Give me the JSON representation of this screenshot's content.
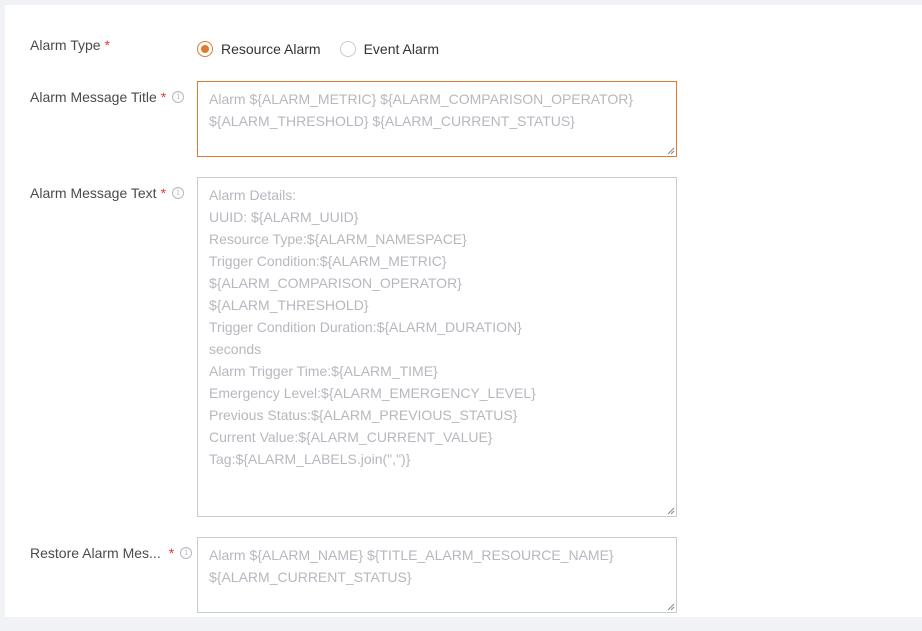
{
  "form": {
    "alarm_type": {
      "label": "Alarm Type",
      "required_mark": "*",
      "options": [
        {
          "label": "Resource Alarm",
          "checked": true
        },
        {
          "label": "Event Alarm",
          "checked": false
        }
      ]
    },
    "message_title": {
      "label": "Alarm Message Title",
      "required_mark": "*",
      "info_icon": "ⓘ",
      "placeholder": "Alarm ${ALARM_METRIC} ${ALARM_COMPARISON_OPERATOR} ${ALARM_THRESHOLD} ${ALARM_CURRENT_STATUS}"
    },
    "message_text": {
      "label": "Alarm Message Text",
      "required_mark": "*",
      "info_icon": "ⓘ",
      "placeholder": "Alarm Details:\nUUID: ${ALARM_UUID}\nResource Type:${ALARM_NAMESPACE}\nTrigger Condition:${ALARM_METRIC}\n${ALARM_COMPARISON_OPERATOR}\n${ALARM_THRESHOLD}\nTrigger Condition Duration:${ALARM_DURATION}\nseconds\nAlarm Trigger Time:${ALARM_TIME}\nEmergency Level:${ALARM_EMERGENCY_LEVEL}\nPrevious Status:${ALARM_PREVIOUS_STATUS}\nCurrent Value:${ALARM_CURRENT_VALUE}\nTag:${ALARM_LABELS.join(\",\")}"
    },
    "restore_message": {
      "label": "Restore Alarm Mes...",
      "required_mark": "*",
      "info_icon": "ⓘ",
      "placeholder": "Alarm ${ALARM_NAME} ${TITLE_ALARM_RESOURCE_NAME} ${ALARM_CURRENT_STATUS}"
    }
  },
  "colors": {
    "accent": "#e07a2c",
    "required": "#e4393c",
    "border": "#c8ccd2",
    "placeholder": "#b5b8be"
  }
}
